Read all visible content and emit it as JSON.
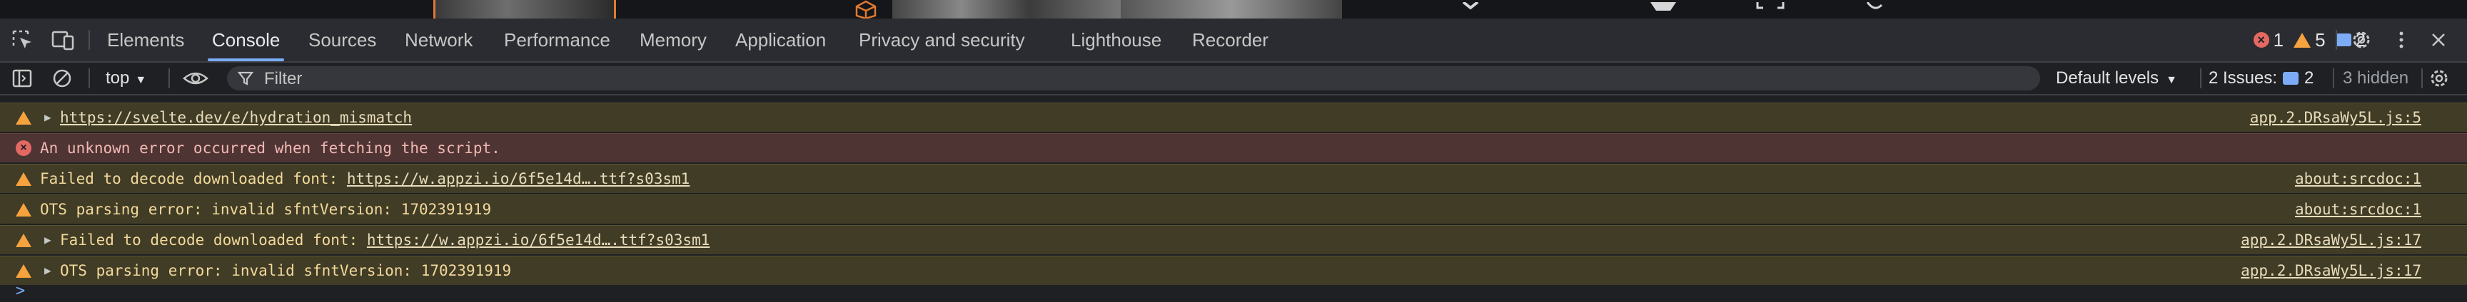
{
  "devtools": {
    "tabs": [
      {
        "label": "Elements"
      },
      {
        "label": "Console"
      },
      {
        "label": "Sources"
      },
      {
        "label": "Network"
      },
      {
        "label": "Performance"
      },
      {
        "label": "Memory"
      },
      {
        "label": "Application"
      },
      {
        "label": "Privacy and security"
      },
      {
        "label": "Lighthouse"
      },
      {
        "label": "Recorder"
      }
    ],
    "active_tab": "Console",
    "badges": {
      "errors": "1",
      "warnings": "5",
      "messages": "2"
    }
  },
  "console_toolbar": {
    "context": "top",
    "filter_placeholder": "Filter",
    "levels": "Default levels",
    "issues_label": "2 Issues:",
    "issues_count": "2",
    "hidden": "3 hidden"
  },
  "messages": [
    {
      "level": "warning",
      "expandable": true,
      "prefix": "",
      "link": "https://svelte.dev/e/hydration_mismatch",
      "suffix": "",
      "source": "app.2.DRsaWy5L.js:5"
    },
    {
      "level": "error",
      "expandable": false,
      "prefix": "An unknown error occurred when fetching the script.",
      "link": "",
      "suffix": "",
      "source": ""
    },
    {
      "level": "warning",
      "expandable": false,
      "prefix": "Failed to decode downloaded font: ",
      "link": "https://w.appzi.io/6f5e14d….ttf?s03sm1",
      "suffix": "",
      "source": "about:srcdoc:1"
    },
    {
      "level": "warning",
      "expandable": false,
      "prefix": "OTS parsing error: invalid sfntVersion: 1702391919",
      "link": "",
      "suffix": "",
      "source": "about:srcdoc:1"
    },
    {
      "level": "warning",
      "expandable": true,
      "prefix": "Failed to decode downloaded font: ",
      "link": "https://w.appzi.io/6f5e14d….ttf?s03sm1",
      "suffix": "",
      "source": "app.2.DRsaWy5L.js:17"
    },
    {
      "level": "warning",
      "expandable": true,
      "prefix": "OTS parsing error: invalid sfntVersion: 1702391919",
      "link": "",
      "suffix": "",
      "source": "app.2.DRsaWy5L.js:17"
    }
  ],
  "prompt_symbol": ">"
}
